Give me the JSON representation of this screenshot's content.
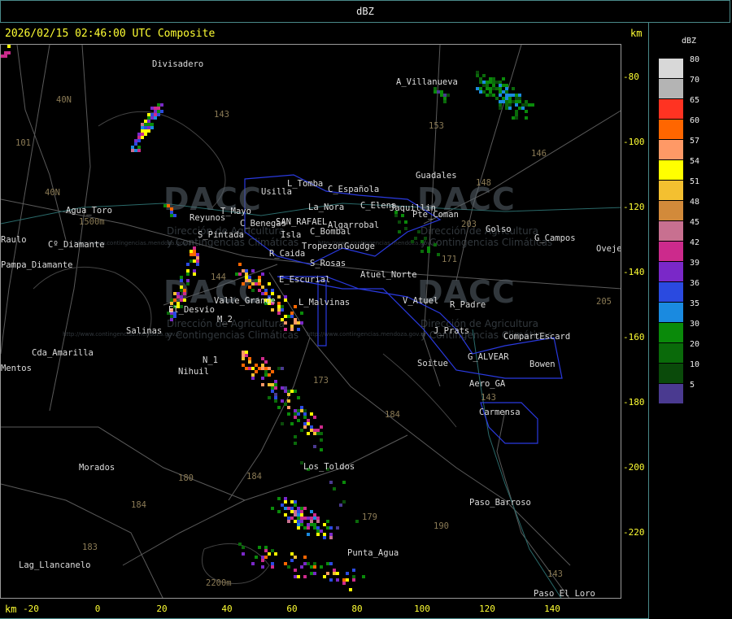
{
  "window_title": "dBZ",
  "header_text": "2026/02/15 02:46:00 UTC Composite",
  "unit_right": "km",
  "unit_bottom": "km",
  "y_ticks": [
    "-80",
    "-100",
    "-120",
    "-140",
    "-160",
    "-180",
    "-200",
    "-220"
  ],
  "x_ticks": [
    "-20",
    "0",
    "20",
    "40",
    "60",
    "80",
    "100",
    "120",
    "140"
  ],
  "legend": {
    "title": "dBZ",
    "levels": [
      {
        "value": "80",
        "color": "#d8d8d8"
      },
      {
        "value": "70",
        "color": "#b4b4b4"
      },
      {
        "value": "65",
        "color": "#ff3322"
      },
      {
        "value": "60",
        "color": "#ff6600"
      },
      {
        "value": "57",
        "color": "#ff9966"
      },
      {
        "value": "54",
        "color": "#ffff00"
      },
      {
        "value": "51",
        "color": "#f4c030"
      },
      {
        "value": "48",
        "color": "#d28a3a"
      },
      {
        "value": "45",
        "color": "#c87090"
      },
      {
        "value": "42",
        "color": "#cc2a8c"
      },
      {
        "value": "39",
        "color": "#7a28c8"
      },
      {
        "value": "36",
        "color": "#2a4ae0"
      },
      {
        "value": "35",
        "color": "#1a8ae0"
      },
      {
        "value": "30",
        "color": "#0a8a0a"
      },
      {
        "value": "20",
        "color": "#0a6a0a"
      },
      {
        "value": "10",
        "color": "#0a4a0a"
      },
      {
        "value": "5",
        "color": "#4a3a90"
      }
    ]
  },
  "watermark": {
    "brand": "DACC",
    "line1": "Dirección de Agricultura",
    "line2": "y Contingencias Climáticas",
    "url": "http://www.contingencias.mendoza.gov.ar"
  },
  "places": [
    "Divisadero",
    "A_Villanueva",
    "Guadales",
    "Usilla",
    "L_Tomba",
    "C_Española",
    "C_Elena",
    "La_Nora",
    "Jaquillin",
    "Pte_Coman",
    "Agua_Toro",
    "Pampa_Diamante",
    "Cº_Diamante",
    "S_Pintada",
    "C_Benegas",
    "SAN_RAFAEL",
    "Algarrobal",
    "C_Bombal",
    "Goudge",
    "Golso",
    "G_Campos",
    "Oveje",
    "R_Caida",
    "S_Rosas",
    "Atuel_Norte",
    "E_Escurial",
    "Valle_Grande",
    "L_Malvinas",
    "V_Atuel",
    "R_Padre",
    "El_Desvio",
    "M_2",
    "Salinas",
    "J_Prats",
    "CompartEscard",
    "Cda_Amarilla",
    "N_1",
    "Nihuil",
    "G_ALVEAR",
    "Bowen",
    "Soitue",
    "Aero_GA",
    "Carmensa",
    "Morados",
    "Los_Toldos",
    "Paso_Barroso",
    "Punta_Agua",
    "Lag_Llancanelo",
    "Paso_El_Loro",
    "Raulo",
    "Reyunos",
    "T_Mayo",
    "Isla",
    "Tropezon",
    "Mentos"
  ],
  "route_numbers": [
    "143",
    "153",
    "146",
    "148",
    "40N",
    "101",
    "40N",
    "203",
    "171",
    "144",
    "173",
    "184",
    "180",
    "184",
    "183",
    "184",
    "179",
    "190",
    "143",
    "143",
    "205",
    "1500m",
    "2200m"
  ]
}
